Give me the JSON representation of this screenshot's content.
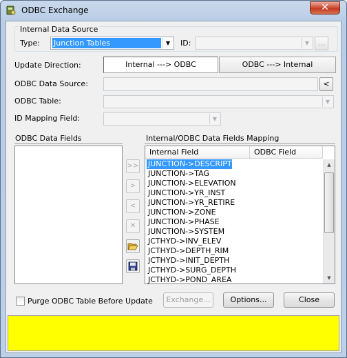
{
  "window": {
    "title": "ODBC Exchange",
    "close_glyph": "✕"
  },
  "internal_source": {
    "group_title": "Internal Data Source",
    "type_label": "Type:",
    "type_value": "Junction Tables",
    "id_label": "ID:",
    "id_value": "",
    "browse_label": "..."
  },
  "update_direction": {
    "label": "Update Direction:",
    "option_internal_to_odbc": "Internal ---> ODBC",
    "option_odbc_to_internal": "ODBC ---> Internal",
    "selected": "Internal ---> ODBC"
  },
  "odbc": {
    "source_label": "ODBC Data Source:",
    "source_button": "<",
    "table_label": "ODBC Table:",
    "id_mapping_label": "ID Mapping Field:"
  },
  "fields_panel": {
    "title": "ODBC Data Fields"
  },
  "mapping_panel": {
    "title": "Internal/ODBC Data Fields Mapping",
    "col_internal": "Internal Field",
    "col_odbc": "ODBC Field",
    "rows": [
      "JUNCTION->DESCRIPT",
      "JUNCTION->TAG",
      "JUNCTION->ELEVATION",
      "JUNCTION->YR_INST",
      "JUNCTION->YR_RETIRE",
      "JUNCTION->ZONE",
      "JUNCTION->PHASE",
      "JUNCTION->SYSTEM",
      "JCTHYD->INV_ELEV",
      "JCTHYD->DEPTH_RIM",
      "JCTHYD->INIT_DEPTH",
      "JCTHYD->SURG_DEPTH",
      "JCTHYD->POND_AREA"
    ],
    "selected_row": "JUNCTION->DESCRIPT"
  },
  "side_buttons": {
    "add_all": ">>",
    "add": ">",
    "remove": "<",
    "clear": "✕"
  },
  "footer": {
    "purge_label": "Purge ODBC Table Before Update",
    "purge_checked": false,
    "exchange_label": "Exchange...",
    "options_label": "Options...",
    "close_label": "Close"
  },
  "status_bar": {
    "text": "",
    "color": "#ffff00"
  },
  "colors": {
    "selection": "#3399ff",
    "title_bar": "#b9cde6",
    "close_button": "#c23b22"
  }
}
